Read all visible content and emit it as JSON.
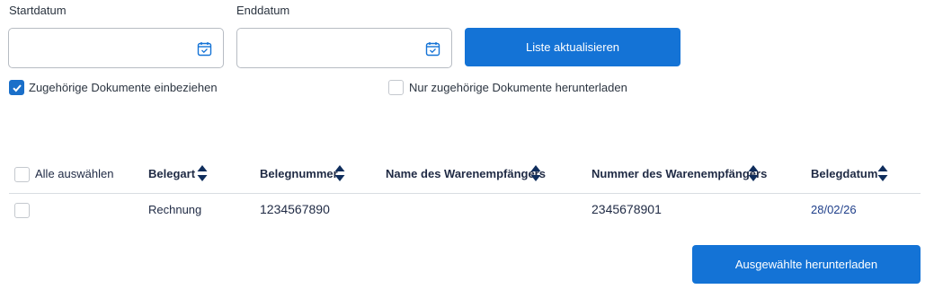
{
  "filters": {
    "start_label": "Startdatum",
    "start_value": "",
    "end_label": "Enddatum",
    "end_value": "",
    "refresh_button": "Liste aktualisieren",
    "include_related_label": "Zugehörige Dokumente einbeziehen",
    "include_related_checked": true,
    "only_related_label": "Nur zugehörige Dokumente herunterladen",
    "only_related_checked": false
  },
  "table": {
    "select_all_label": "Alle auswählen",
    "columns": [
      "Belegart",
      "Belegnummer",
      "Name des Warenempfängers",
      "Nummer des Warenempfängers",
      "Belegdatum"
    ],
    "rows": [
      {
        "checked": false,
        "cells": [
          "Rechnung",
          "1234567890",
          "",
          "2345678901",
          "28/02/26"
        ]
      }
    ]
  },
  "download_button": "Ausgewählte herunterladen",
  "colors": {
    "primary": "#1473d6",
    "checkbox_checked": "#1a6fc9",
    "sort_icon": "#0f2d5c",
    "date_text": "#1f3f8a"
  },
  "icons": {
    "calendar": "calendar-icon",
    "sort": "sort-icon",
    "check": "check-icon"
  }
}
